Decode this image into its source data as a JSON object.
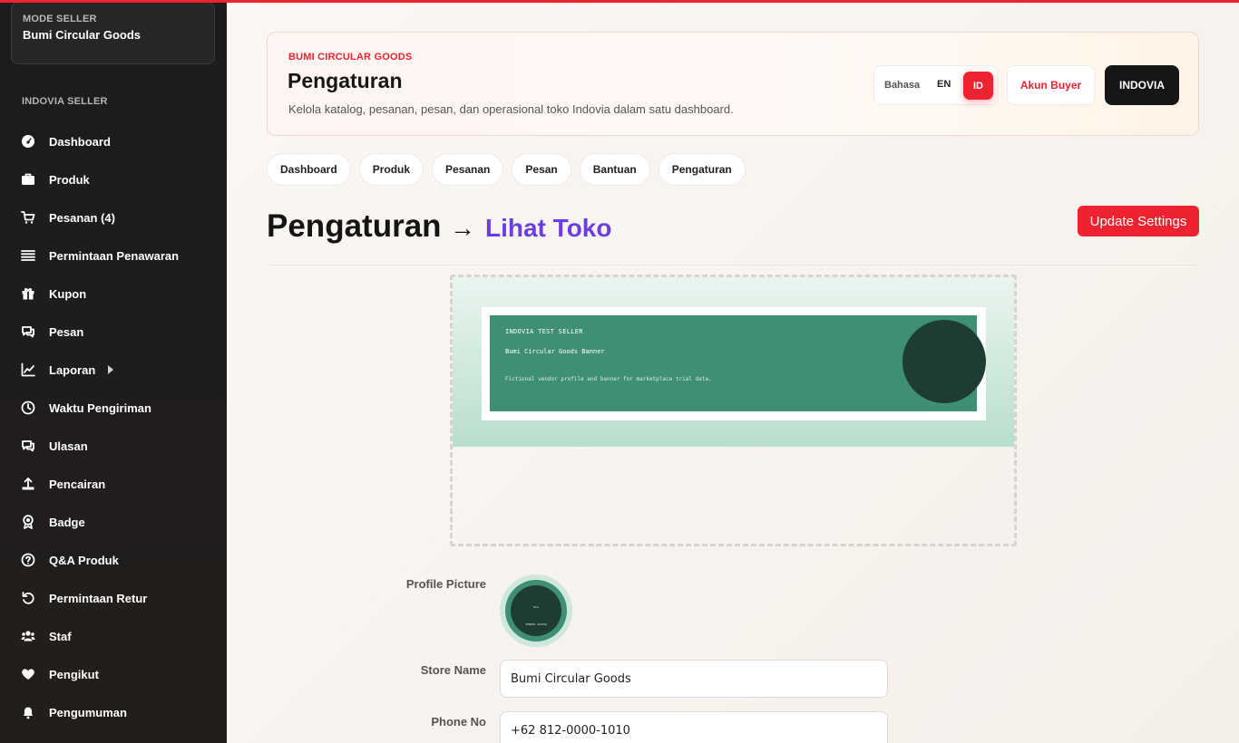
{
  "colors": {
    "accent": "#ee2331",
    "link": "#6a3ee0",
    "sidebar_bg": "#1c1c1c",
    "banner_green": "#3e8f73",
    "banner_dark": "#1f3c33"
  },
  "sidebar": {
    "mode_label": "MODE SELLER",
    "store_name": "Bumi Circular Goods",
    "heading": "INDOVIA SELLER",
    "items": [
      {
        "label": "Dashboard",
        "icon": "dashboard-icon"
      },
      {
        "label": "Produk",
        "icon": "briefcase-icon"
      },
      {
        "label": "Pesanan (4)",
        "icon": "cart-icon"
      },
      {
        "label": "Permintaan Penawaran",
        "icon": "list-icon"
      },
      {
        "label": "Kupon",
        "icon": "gift-icon"
      },
      {
        "label": "Pesan",
        "icon": "chat-icon"
      },
      {
        "label": "Laporan",
        "icon": "chart-line-icon"
      },
      {
        "label": "Waktu Pengiriman",
        "icon": "clock-icon"
      },
      {
        "label": "Ulasan",
        "icon": "comments-icon"
      },
      {
        "label": "Pencairan",
        "icon": "upload-icon"
      },
      {
        "label": "Badge",
        "icon": "award-icon"
      },
      {
        "label": "Q&A Produk",
        "icon": "question-circle-icon"
      },
      {
        "label": "Permintaan Retur",
        "icon": "undo-icon"
      },
      {
        "label": "Staf",
        "icon": "users-icon"
      },
      {
        "label": "Pengikut",
        "icon": "heart-icon"
      },
      {
        "label": "Pengumuman",
        "icon": "bell-icon"
      }
    ]
  },
  "header": {
    "brand": "BUMI CIRCULAR GOODS",
    "title": "Pengaturan",
    "subtitle": "Kelola katalog, pesanan, pesan, dan operasional toko Indovia dalam satu dashboard.",
    "language_label": "Bahasa",
    "lang_en": "EN",
    "lang_id": "ID",
    "buyer_button": "Akun Buyer",
    "indovia_button": "INDOVIA"
  },
  "tabs": [
    "Dashboard",
    "Produk",
    "Pesanan",
    "Pesan",
    "Bantuan",
    "Pengaturan"
  ],
  "page": {
    "title": "Pengaturan",
    "arrow": "→",
    "view_store": "Lihat Toko",
    "update_button": "Update Settings"
  },
  "banner": {
    "kicker": "INDOVIA TEST SELLER",
    "title": "Bumi Circular Goods Banner",
    "description": "Fictional vendor profile and banner for marketplace trial data."
  },
  "form": {
    "profile_picture_label": "Profile Picture",
    "avatar_line1": "BCG",
    "avatar_line2": "VENDOR AVATAR",
    "store_name_label": "Store Name",
    "store_name_value": "Bumi Circular Goods",
    "phone_label": "Phone No",
    "phone_value": "+62 812-0000-1010"
  }
}
